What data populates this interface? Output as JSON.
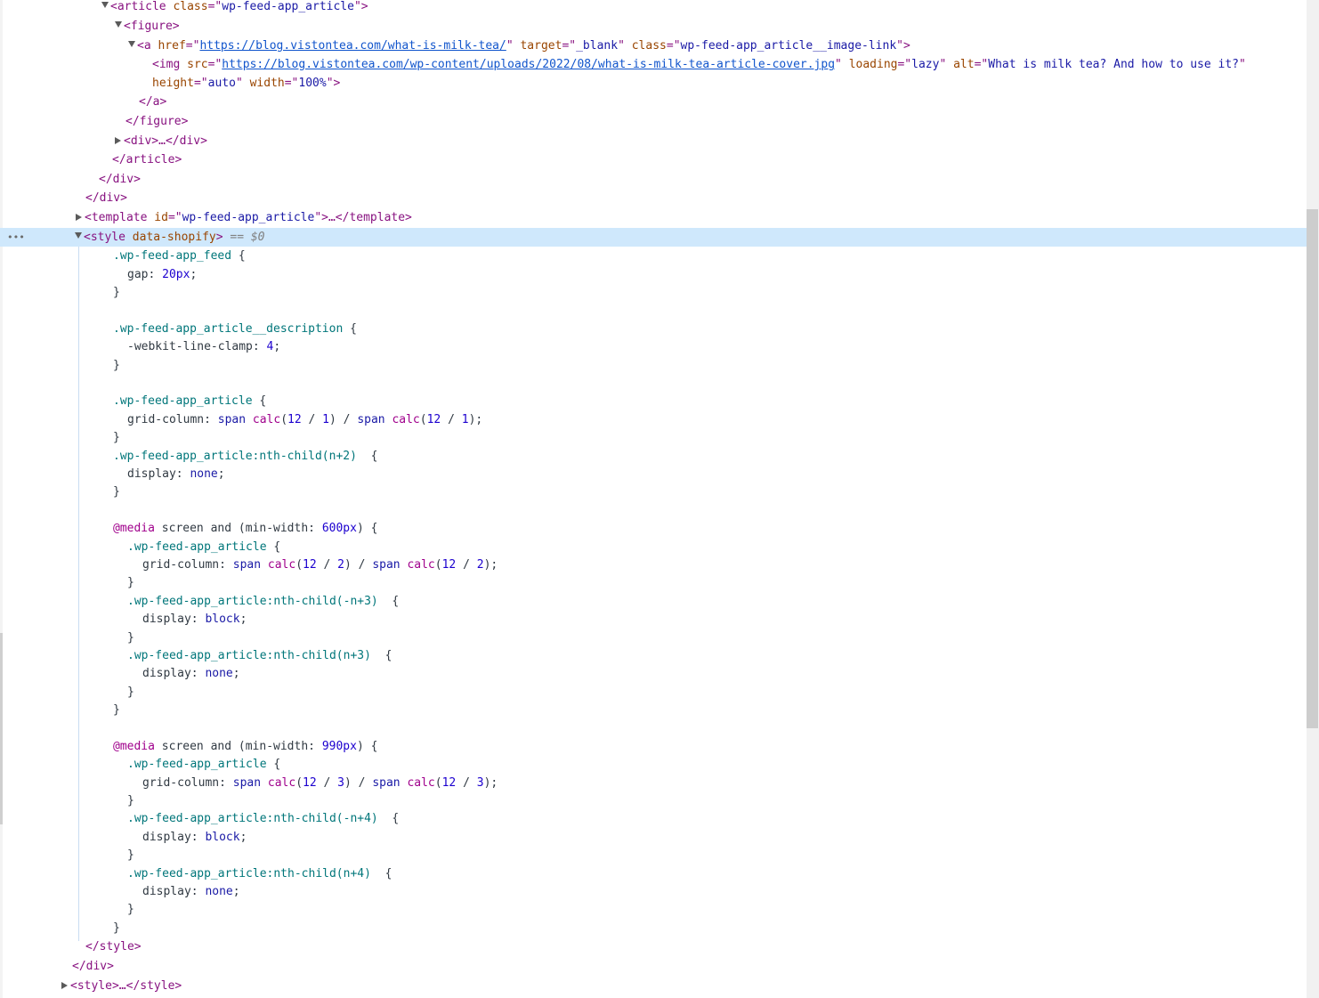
{
  "panel": "Elements",
  "selected_marker": "== $0",
  "lines": {
    "l0": {
      "tag_open": "<article ",
      "attr": "class",
      "value": "wp-feed-app_article",
      "tag_close": ">"
    },
    "l1": {
      "tag": "<figure>"
    },
    "l2": {
      "tag_open": "<a ",
      "attr1": "href",
      "link1": "https://blog.vistontea.com/what-is-milk-tea/",
      "attr2": "target",
      "value2": "_blank",
      "attr3": "class",
      "value3": "wp-feed-app_article__image-link",
      "tag_close": ">"
    },
    "l3": {
      "tag_open": "<img ",
      "attr1": "src",
      "link1": "https://blog.vistontea.com/wp-content/uploads/2022/08/what-is-milk-tea-article-cover.jpg",
      "attr2": "loading",
      "value2": "lazy",
      "attr3": "alt",
      "value3": "What is milk tea? And how to use it?"
    },
    "l4": {
      "attr1": "height",
      "value1": "auto",
      "attr2": "width",
      "value2": "100%",
      "tag_close": ">"
    },
    "l5": {
      "tag": "</a>"
    },
    "l6": {
      "tag": "</figure>"
    },
    "l7": {
      "tag": "<div>…</div>"
    },
    "l8": {
      "tag": "</article>"
    },
    "l9": {
      "tag": "</div>"
    },
    "l10": {
      "tag": "</div>"
    },
    "l11": {
      "tag_open": "<template ",
      "attr": "id",
      "value": "wp-feed-app_article",
      "tag_close": ">…</template>"
    },
    "l12": {
      "tag": "<style ",
      "attr": "data-shopify",
      "tag_close": ">"
    },
    "css": {
      "r1_sel": ".wp-feed-app_feed",
      "r1_prop": "gap",
      "r1_val": "20px",
      "r2_sel": ".wp-feed-app_article__description",
      "r2_prop": "-webkit-line-clamp",
      "r2_val": "4",
      "r3_sel": ".wp-feed-app_article",
      "r3_prop": "grid-column",
      "r4_sel": ".wp-feed-app_article:nth-child(n+2)",
      "r4_prop": "display",
      "r4_val": "none",
      "m1": "@media",
      "m1_rest": " screen and (min-width: ",
      "m1_num": "600px",
      "m1_end": ") {",
      "m1_r1_sel": ".wp-feed-app_article",
      "m1_r2_sel": ".wp-feed-app_article:nth-child(-n+3)",
      "m1_r2_val": "block",
      "m1_r3_sel": ".wp-feed-app_article:nth-child(n+3)",
      "m1_r3_val": "none",
      "m2_num": "990px",
      "m2_r2_sel": ".wp-feed-app_article:nth-child(-n+4)",
      "m2_r3_sel": ".wp-feed-app_article:nth-child(n+4)",
      "divisor1": "1",
      "divisor2": "2",
      "divisor3": "3"
    },
    "l_end_style": "</style>",
    "l_end_div": "</div>",
    "l_last": "<style>…</style>"
  }
}
